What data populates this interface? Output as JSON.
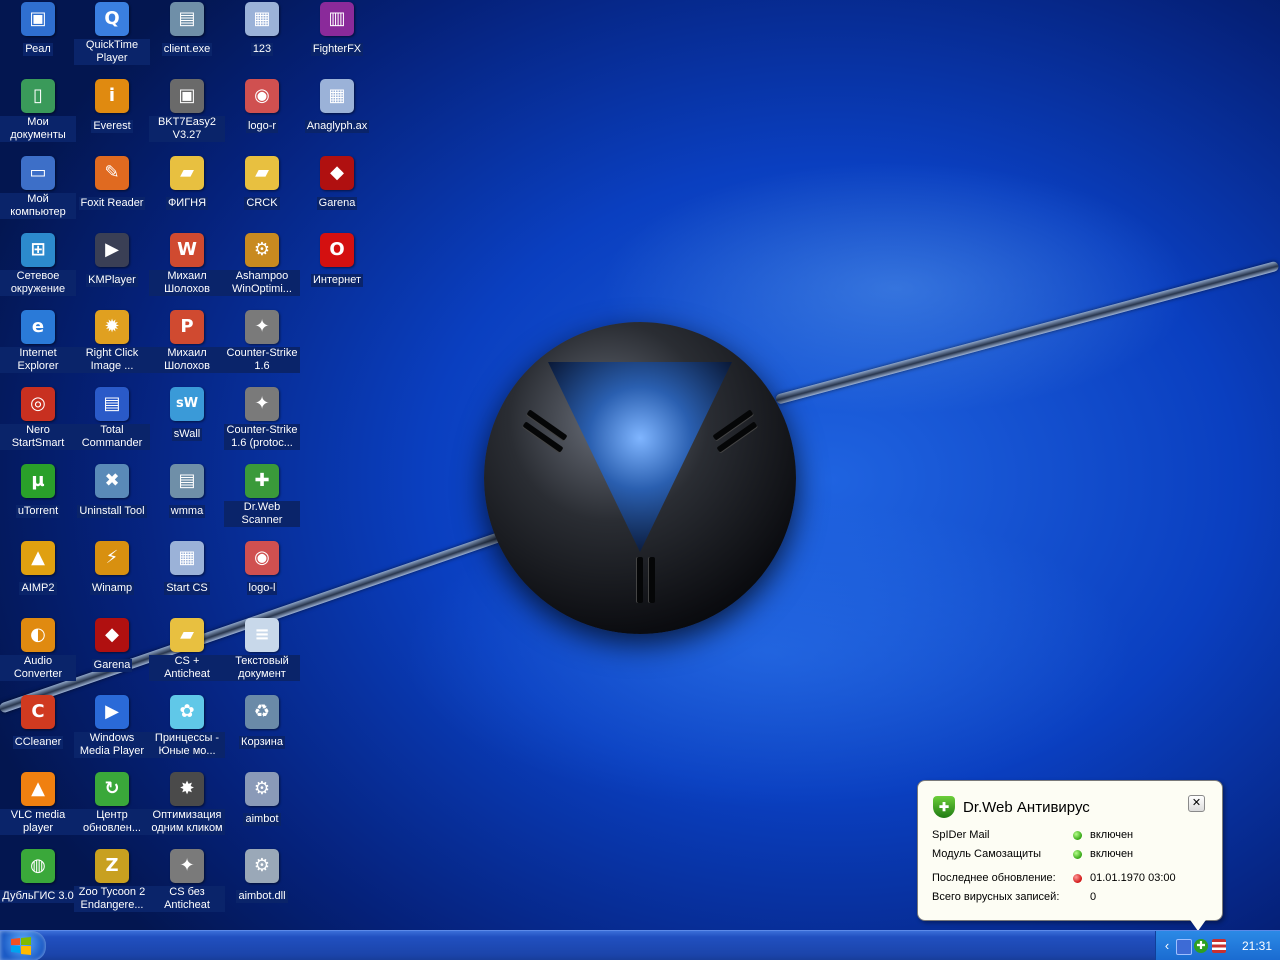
{
  "desktop": {
    "icons": [
      {
        "label": "Реал",
        "icon": "window-icon"
      },
      {
        "label": "QuickTime Player",
        "icon": "quicktime-icon"
      },
      {
        "label": "client.exe",
        "icon": "exe-icon"
      },
      {
        "label": "123",
        "icon": "document-icon"
      },
      {
        "label": "FighterFX",
        "icon": "archive-icon"
      },
      {
        "label": "Мои документы",
        "icon": "my-documents-icon"
      },
      {
        "label": "Everest",
        "icon": "everest-icon"
      },
      {
        "label": "BKT7Easy2 V3.27",
        "icon": "program-icon"
      },
      {
        "label": "logo-r",
        "icon": "png-icon"
      },
      {
        "label": "Anaglyph.ax",
        "icon": "file-icon"
      },
      {
        "label": "Мой компьютер",
        "icon": "my-computer-icon"
      },
      {
        "label": "Foxit Reader",
        "icon": "foxit-reader-icon"
      },
      {
        "label": "ФИГНЯ",
        "icon": "folder-icon"
      },
      {
        "label": "CRCK",
        "icon": "folder-icon"
      },
      {
        "label": "Garena",
        "icon": "garena-icon"
      },
      {
        "label": "Сетевое окружение",
        "icon": "network-icon"
      },
      {
        "label": "KMPlayer",
        "icon": "kmplayer-icon"
      },
      {
        "label": "Михаил Шолохов",
        "icon": "word-document-icon"
      },
      {
        "label": "Ashampoo WinOptimi...",
        "icon": "ashampoo-icon"
      },
      {
        "label": "Интернет",
        "icon": "opera-icon"
      },
      {
        "label": "Internet Explorer",
        "icon": "internet-explorer-icon"
      },
      {
        "label": "Right Click Image ...",
        "icon": "right-click-image-icon"
      },
      {
        "label": "Михаил Шолохов",
        "icon": "powerpoint-document-icon"
      },
      {
        "label": "Counter-Strike 1.6",
        "icon": "counter-strike-icon"
      },
      {
        "label": "Nero StartSmart",
        "icon": "nero-icon"
      },
      {
        "label": "Total Commander",
        "icon": "total-commander-icon"
      },
      {
        "label": "sWall",
        "icon": "swall-icon"
      },
      {
        "label": "Counter-Strike 1.6 (protoc...",
        "icon": "counter-strike-icon"
      },
      {
        "label": "uTorrent",
        "icon": "utorrent-icon"
      },
      {
        "label": "Uninstall Tool",
        "icon": "uninstall-tool-icon"
      },
      {
        "label": "wmma",
        "icon": "exe-icon"
      },
      {
        "label": "Dr.Web Scanner",
        "icon": "drweb-scanner-icon"
      },
      {
        "label": "AIMP2",
        "icon": "aimp-icon"
      },
      {
        "label": "Winamp",
        "icon": "winamp-icon"
      },
      {
        "label": "Start CS",
        "icon": "document-icon"
      },
      {
        "label": "logo-l",
        "icon": "png-icon"
      },
      {
        "label": "Audio Converter",
        "icon": "audio-converter-icon"
      },
      {
        "label": "Garena",
        "icon": "garena-icon"
      },
      {
        "label": "CS + Anticheat",
        "icon": "folder-icon"
      },
      {
        "label": "Текстовый документ",
        "icon": "text-document-icon"
      },
      {
        "label": "CCleaner",
        "icon": "ccleaner-icon"
      },
      {
        "label": "Windows Media Player",
        "icon": "media-player-icon"
      },
      {
        "label": "Принцессы - Юные мо...",
        "icon": "game-icon"
      },
      {
        "label": "Корзина",
        "icon": "recycle-bin-icon"
      },
      {
        "label": "VLC media player",
        "icon": "vlc-icon"
      },
      {
        "label": "Центр обновлен...",
        "icon": "update-center-icon"
      },
      {
        "label": "Оптимизация одним кликом",
        "icon": "optimize-icon"
      },
      {
        "label": "aimbot",
        "icon": "settings-file-icon"
      },
      {
        "label": "ДубльГИС 3.0",
        "icon": "dublgis-icon"
      },
      {
        "label": "Zoo Tycoon 2 Endangere...",
        "icon": "zoo-tycoon-icon"
      },
      {
        "label": "CS без Anticheat",
        "icon": "counter-strike-icon"
      },
      {
        "label": "aimbot.dll",
        "icon": "dll-icon"
      }
    ]
  },
  "balloon": {
    "title": "Dr.Web Антивирус",
    "icon": "drweb-shield-icon",
    "rows": [
      {
        "label": "SpIDer Mail",
        "value": "включен",
        "status": "green"
      },
      {
        "label": "Модуль Самозащиты",
        "value": "включен",
        "status": "green"
      },
      {
        "label": "Последнее обновление:",
        "value": "01.01.1970 03:00",
        "status": "red"
      },
      {
        "label": "Всего вирусных записей:",
        "value": "0",
        "status": ""
      }
    ]
  },
  "taskbar": {
    "clock": "21:31",
    "colors": {
      "taskbar": "#1b44aa",
      "tray": "#1a6ad0",
      "start": "#1c5bc6"
    }
  }
}
